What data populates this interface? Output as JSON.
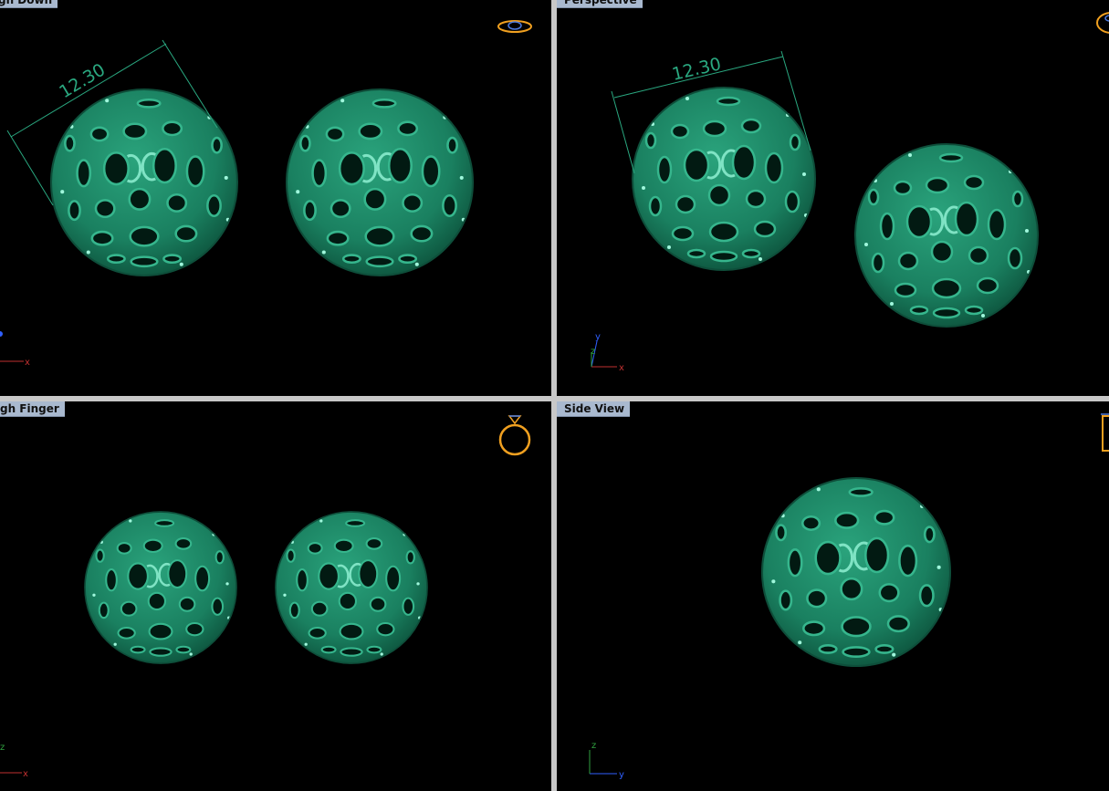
{
  "viewports": {
    "top_left": {
      "label": "gh Down"
    },
    "top_right": {
      "label": "Perspective"
    },
    "bottom_left": {
      "label": "gh Finger"
    },
    "bottom_right": {
      "label": "Side View"
    }
  },
  "dimensions": {
    "top_left": {
      "value": "12.30"
    },
    "top_right": {
      "value": "12.30"
    }
  },
  "axes": {
    "top_left": {
      "x": "x"
    },
    "top_right": {
      "x": "x",
      "y": "y",
      "z": "z"
    },
    "bottom_left": {
      "x": "x",
      "z": "z"
    },
    "bottom_right": {
      "y": "y",
      "z": "z"
    }
  },
  "icons": {
    "top_left": "ring-top-view-icon",
    "top_right": "ring-perspective-icon",
    "bottom_left": "ring-front-view-icon",
    "bottom_right": "ring-side-view-icon"
  },
  "colors": {
    "background": "#000000",
    "model": "#1f8a66",
    "dimension": "#2aa880",
    "icon": "#f0a020",
    "divider": "#c8c8c8",
    "tab": "#a9b9cf"
  }
}
